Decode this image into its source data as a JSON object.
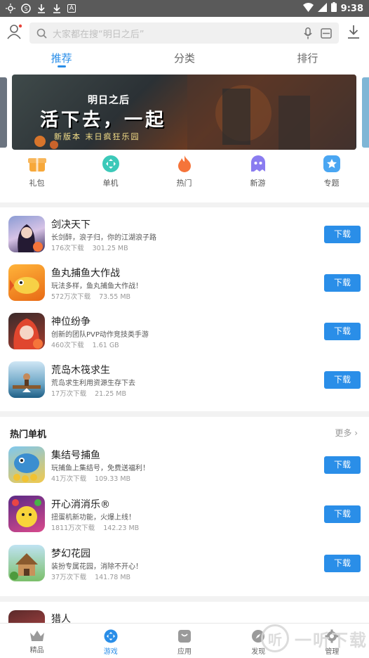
{
  "status": {
    "time": "9:38",
    "box_glyph": "A"
  },
  "search": {
    "placeholder": "大家都在搜“明日之后”"
  },
  "tabs": [
    {
      "label": "推荐",
      "active": true
    },
    {
      "label": "分类",
      "active": false
    },
    {
      "label": "排行",
      "active": false
    }
  ],
  "banner": {
    "logo": "明日之后",
    "slogan": "活下去，一起",
    "sub": "新版本  末日疯狂乐园"
  },
  "quick": [
    {
      "label": "礼包",
      "icon": "gift-icon",
      "color": "#f7a83a"
    },
    {
      "label": "单机",
      "icon": "gamepad-icon",
      "color": "#3cc9b9"
    },
    {
      "label": "热门",
      "icon": "flame-icon",
      "color": "#f5743a"
    },
    {
      "label": "新游",
      "icon": "ghost-icon",
      "color": "#8a7cf0"
    },
    {
      "label": "专题",
      "icon": "star-badge-icon",
      "color": "#4aa6f2"
    }
  ],
  "apps": [
    {
      "name": "剑决天下",
      "desc": "长剑醉，浪子归，你的江湖浪子路",
      "downloads": "176次下载",
      "size": "301.25 MB",
      "button": "下载"
    },
    {
      "name": "鱼丸捕鱼大作战",
      "desc": "玩法多样，鱼丸捕鱼大作战！",
      "downloads": "572万次下载",
      "size": "73.55 MB",
      "button": "下载"
    },
    {
      "name": "神位纷争",
      "desc": "创新的团队PVP动作竞技类手游",
      "downloads": "460次下载",
      "size": "1.61 GB",
      "button": "下载"
    },
    {
      "name": "荒岛木筏求生",
      "desc": "荒岛求生利用资源生存下去",
      "downloads": "17万次下载",
      "size": "21.25 MB",
      "button": "下载"
    }
  ],
  "hot_section": {
    "title": "热门单机",
    "more": "更多",
    "items": [
      {
        "name": "集结号捕鱼",
        "desc": "玩捕鱼上集结号，免费送福利！",
        "downloads": "41万次下载",
        "size": "109.33 MB",
        "button": "下载"
      },
      {
        "name": "开心消消乐®",
        "desc": "扭蛋机新功能，火爆上线！",
        "downloads": "1811万次下载",
        "size": "142.23 MB",
        "button": "下载"
      },
      {
        "name": "梦幻花园",
        "desc": "装扮专属花园，消除不开心！",
        "downloads": "37万次下载",
        "size": "141.78 MB",
        "button": "下载"
      }
    ]
  },
  "partial_item": {
    "name": "猎人"
  },
  "bottom_nav": [
    {
      "label": "精品",
      "icon": "crown-icon",
      "active": false
    },
    {
      "label": "游戏",
      "icon": "game-icon",
      "active": true
    },
    {
      "label": "应用",
      "icon": "app-bag-icon",
      "active": false
    },
    {
      "label": "发现",
      "icon": "discover-icon",
      "active": false
    },
    {
      "label": "管理",
      "icon": "gear-icon",
      "active": false
    }
  ],
  "watermark": {
    "glyph": "听",
    "text": "一听下载"
  },
  "colors": {
    "accent": "#2a8ee8"
  }
}
